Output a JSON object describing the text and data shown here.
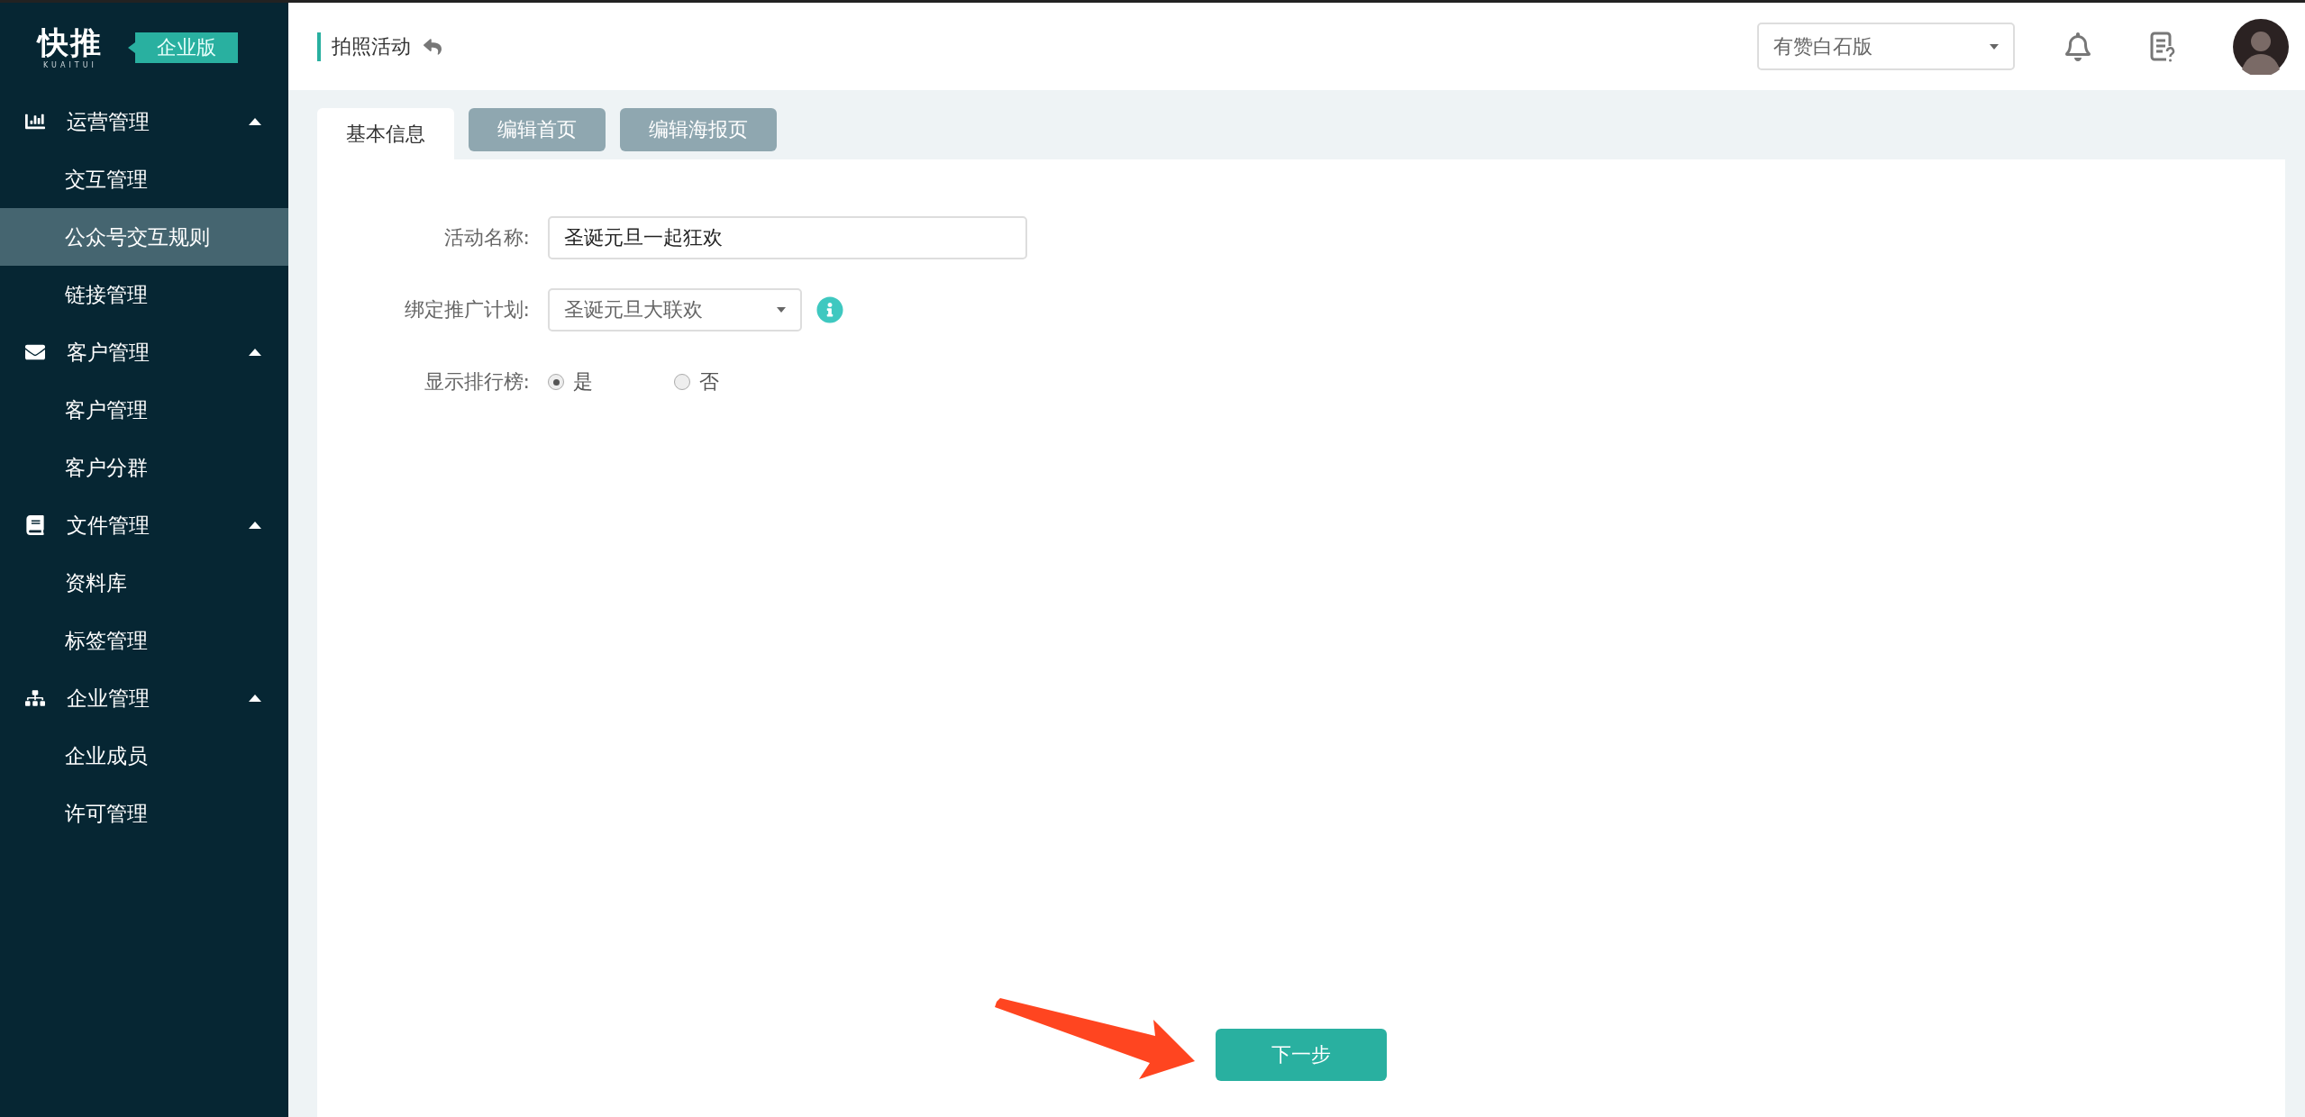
{
  "logo": {
    "name": "快推",
    "subtitle": "KUAITUI",
    "edition": "企业版"
  },
  "sidebar": {
    "groups": [
      {
        "title": "运营管理",
        "expanded": true,
        "items": [
          {
            "label": "交互管理",
            "selected": false
          },
          {
            "label": "公众号交互规则",
            "selected": true
          },
          {
            "label": "链接管理",
            "selected": false
          }
        ]
      },
      {
        "title": "客户管理",
        "expanded": true,
        "items": [
          {
            "label": "客户管理",
            "selected": false
          },
          {
            "label": "客户分群",
            "selected": false
          }
        ]
      },
      {
        "title": "文件管理",
        "expanded": true,
        "items": [
          {
            "label": "资料库",
            "selected": false
          },
          {
            "label": "标签管理",
            "selected": false
          }
        ]
      },
      {
        "title": "企业管理",
        "expanded": true,
        "items": [
          {
            "label": "企业成员",
            "selected": false
          },
          {
            "label": "许可管理",
            "selected": false
          }
        ]
      }
    ]
  },
  "header": {
    "title": "拍照活动",
    "account_select": {
      "value": "有赞白石版"
    }
  },
  "tabs": [
    {
      "label": "基本信息",
      "selected": true
    },
    {
      "label": "编辑首页",
      "selected": false
    },
    {
      "label": "编辑海报页",
      "selected": false
    }
  ],
  "form": {
    "fields": [
      {
        "kind": "text",
        "label": "活动名称:",
        "value": "圣诞元旦一起狂欢"
      },
      {
        "kind": "select",
        "label": "绑定推广计划:",
        "value": "圣诞元旦大联欢",
        "info": true
      },
      {
        "kind": "radio",
        "label": "显示排行榜:",
        "options": [
          {
            "label": "是",
            "selected": true
          },
          {
            "label": "否",
            "selected": false
          }
        ]
      }
    ]
  },
  "next_button": "下一步"
}
